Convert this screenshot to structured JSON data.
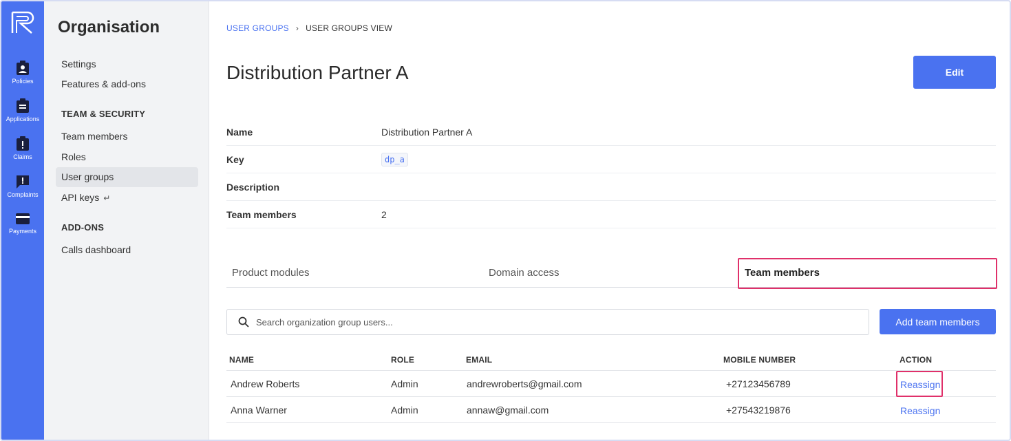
{
  "rail": {
    "items": [
      {
        "label": "Policies",
        "icon": "policies-icon"
      },
      {
        "label": "Applications",
        "icon": "applications-icon"
      },
      {
        "label": "Claims",
        "icon": "claims-icon"
      },
      {
        "label": "Complaints",
        "icon": "complaints-icon"
      },
      {
        "label": "Payments",
        "icon": "payments-icon"
      }
    ],
    "color": "#4a72f0"
  },
  "subnav": {
    "title": "Organisation",
    "items": [
      {
        "label": "Settings"
      },
      {
        "label": "Features & add-ons"
      }
    ],
    "team_section": "TEAM & SECURITY",
    "team_items": [
      {
        "label": "Team members"
      },
      {
        "label": "Roles"
      },
      {
        "label": "User groups",
        "active": true
      },
      {
        "label": "API keys",
        "icon": "return-icon"
      }
    ],
    "addons_section": "ADD-ONS",
    "addons_items": [
      {
        "label": "Calls dashboard"
      }
    ]
  },
  "breadcrumb": {
    "link": "USER GROUPS",
    "current": "USER GROUPS VIEW"
  },
  "page": {
    "title": "Distribution Partner A",
    "edit_label": "Edit"
  },
  "details": {
    "name_label": "Name",
    "name_value": "Distribution Partner A",
    "key_label": "Key",
    "key_value": "dp_a",
    "description_label": "Description",
    "description_value": "",
    "members_label": "Team members",
    "members_value": "2"
  },
  "tabs": [
    {
      "label": "Product modules"
    },
    {
      "label": "Domain access"
    },
    {
      "label": "Team members",
      "active": true
    }
  ],
  "search": {
    "placeholder": "Search organization group users..."
  },
  "add_button": "Add team members",
  "table": {
    "headers": [
      "NAME",
      "ROLE",
      "EMAIL",
      "MOBILE NUMBER",
      "ACTION"
    ],
    "rows": [
      {
        "name": "Andrew Roberts",
        "role": "Admin",
        "email": "andrewroberts@gmail.com",
        "mobile": "+27123456789",
        "action": "Reassign"
      },
      {
        "name": "Anna Warner",
        "role": "Admin",
        "email": "annaw@gmail.com",
        "mobile": "+27543219876",
        "action": "Reassign"
      }
    ]
  },
  "colors": {
    "accent": "#4a72f0",
    "highlight": "#e0306a"
  }
}
